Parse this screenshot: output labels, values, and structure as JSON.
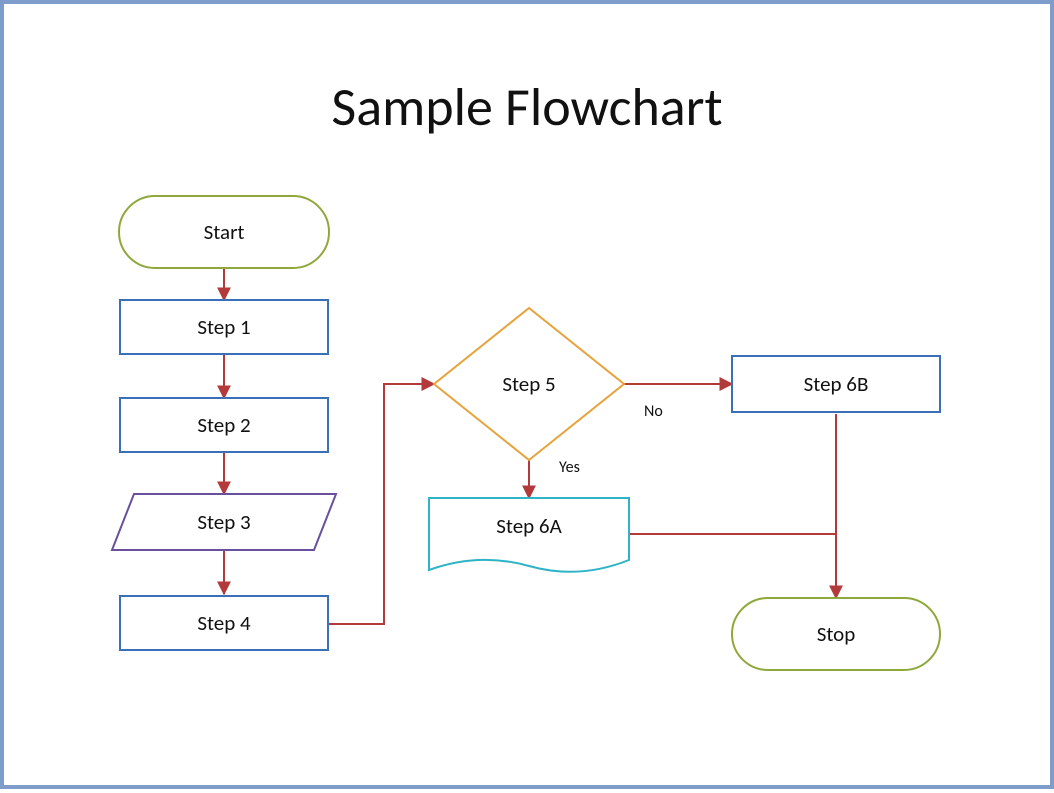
{
  "title": "Sample Flowchart",
  "nodes": {
    "start": "Start",
    "step1": "Step 1",
    "step2": "Step 2",
    "step3": "Step 3",
    "step4": "Step 4",
    "step5": "Step 5",
    "step6a": "Step 6A",
    "step6b": "Step 6B",
    "stop": "Stop"
  },
  "edges": {
    "no": "No",
    "yes": "Yes"
  },
  "colors": {
    "frame": "#7f9dca",
    "terminator": "#8fa83b",
    "process": "#3b6fb6",
    "io": "#6a4f9e",
    "decision": "#e8a23a",
    "document": "#2fb3c7",
    "connector": "#b23a3a"
  }
}
